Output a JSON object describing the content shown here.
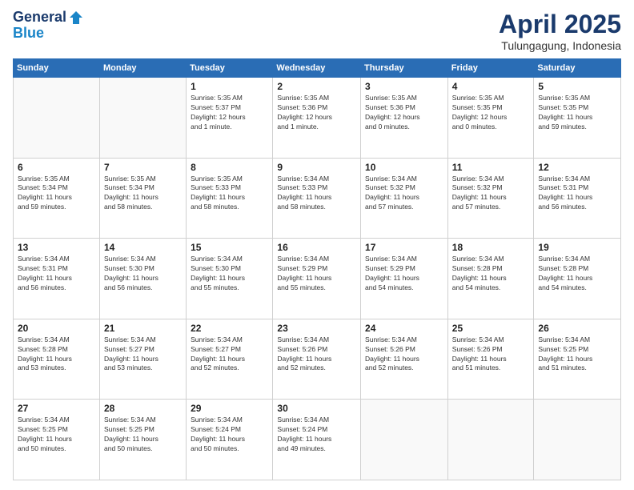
{
  "header": {
    "logo_line1": "General",
    "logo_line2": "Blue",
    "month": "April 2025",
    "location": "Tulungagung, Indonesia"
  },
  "weekdays": [
    "Sunday",
    "Monday",
    "Tuesday",
    "Wednesday",
    "Thursday",
    "Friday",
    "Saturday"
  ],
  "weeks": [
    [
      {
        "day": "",
        "info": ""
      },
      {
        "day": "",
        "info": ""
      },
      {
        "day": "1",
        "info": "Sunrise: 5:35 AM\nSunset: 5:37 PM\nDaylight: 12 hours\nand 1 minute."
      },
      {
        "day": "2",
        "info": "Sunrise: 5:35 AM\nSunset: 5:36 PM\nDaylight: 12 hours\nand 1 minute."
      },
      {
        "day": "3",
        "info": "Sunrise: 5:35 AM\nSunset: 5:36 PM\nDaylight: 12 hours\nand 0 minutes."
      },
      {
        "day": "4",
        "info": "Sunrise: 5:35 AM\nSunset: 5:35 PM\nDaylight: 12 hours\nand 0 minutes."
      },
      {
        "day": "5",
        "info": "Sunrise: 5:35 AM\nSunset: 5:35 PM\nDaylight: 11 hours\nand 59 minutes."
      }
    ],
    [
      {
        "day": "6",
        "info": "Sunrise: 5:35 AM\nSunset: 5:34 PM\nDaylight: 11 hours\nand 59 minutes."
      },
      {
        "day": "7",
        "info": "Sunrise: 5:35 AM\nSunset: 5:34 PM\nDaylight: 11 hours\nand 58 minutes."
      },
      {
        "day": "8",
        "info": "Sunrise: 5:35 AM\nSunset: 5:33 PM\nDaylight: 11 hours\nand 58 minutes."
      },
      {
        "day": "9",
        "info": "Sunrise: 5:34 AM\nSunset: 5:33 PM\nDaylight: 11 hours\nand 58 minutes."
      },
      {
        "day": "10",
        "info": "Sunrise: 5:34 AM\nSunset: 5:32 PM\nDaylight: 11 hours\nand 57 minutes."
      },
      {
        "day": "11",
        "info": "Sunrise: 5:34 AM\nSunset: 5:32 PM\nDaylight: 11 hours\nand 57 minutes."
      },
      {
        "day": "12",
        "info": "Sunrise: 5:34 AM\nSunset: 5:31 PM\nDaylight: 11 hours\nand 56 minutes."
      }
    ],
    [
      {
        "day": "13",
        "info": "Sunrise: 5:34 AM\nSunset: 5:31 PM\nDaylight: 11 hours\nand 56 minutes."
      },
      {
        "day": "14",
        "info": "Sunrise: 5:34 AM\nSunset: 5:30 PM\nDaylight: 11 hours\nand 56 minutes."
      },
      {
        "day": "15",
        "info": "Sunrise: 5:34 AM\nSunset: 5:30 PM\nDaylight: 11 hours\nand 55 minutes."
      },
      {
        "day": "16",
        "info": "Sunrise: 5:34 AM\nSunset: 5:29 PM\nDaylight: 11 hours\nand 55 minutes."
      },
      {
        "day": "17",
        "info": "Sunrise: 5:34 AM\nSunset: 5:29 PM\nDaylight: 11 hours\nand 54 minutes."
      },
      {
        "day": "18",
        "info": "Sunrise: 5:34 AM\nSunset: 5:28 PM\nDaylight: 11 hours\nand 54 minutes."
      },
      {
        "day": "19",
        "info": "Sunrise: 5:34 AM\nSunset: 5:28 PM\nDaylight: 11 hours\nand 54 minutes."
      }
    ],
    [
      {
        "day": "20",
        "info": "Sunrise: 5:34 AM\nSunset: 5:28 PM\nDaylight: 11 hours\nand 53 minutes."
      },
      {
        "day": "21",
        "info": "Sunrise: 5:34 AM\nSunset: 5:27 PM\nDaylight: 11 hours\nand 53 minutes."
      },
      {
        "day": "22",
        "info": "Sunrise: 5:34 AM\nSunset: 5:27 PM\nDaylight: 11 hours\nand 52 minutes."
      },
      {
        "day": "23",
        "info": "Sunrise: 5:34 AM\nSunset: 5:26 PM\nDaylight: 11 hours\nand 52 minutes."
      },
      {
        "day": "24",
        "info": "Sunrise: 5:34 AM\nSunset: 5:26 PM\nDaylight: 11 hours\nand 52 minutes."
      },
      {
        "day": "25",
        "info": "Sunrise: 5:34 AM\nSunset: 5:26 PM\nDaylight: 11 hours\nand 51 minutes."
      },
      {
        "day": "26",
        "info": "Sunrise: 5:34 AM\nSunset: 5:25 PM\nDaylight: 11 hours\nand 51 minutes."
      }
    ],
    [
      {
        "day": "27",
        "info": "Sunrise: 5:34 AM\nSunset: 5:25 PM\nDaylight: 11 hours\nand 50 minutes."
      },
      {
        "day": "28",
        "info": "Sunrise: 5:34 AM\nSunset: 5:25 PM\nDaylight: 11 hours\nand 50 minutes."
      },
      {
        "day": "29",
        "info": "Sunrise: 5:34 AM\nSunset: 5:24 PM\nDaylight: 11 hours\nand 50 minutes."
      },
      {
        "day": "30",
        "info": "Sunrise: 5:34 AM\nSunset: 5:24 PM\nDaylight: 11 hours\nand 49 minutes."
      },
      {
        "day": "",
        "info": ""
      },
      {
        "day": "",
        "info": ""
      },
      {
        "day": "",
        "info": ""
      }
    ]
  ]
}
